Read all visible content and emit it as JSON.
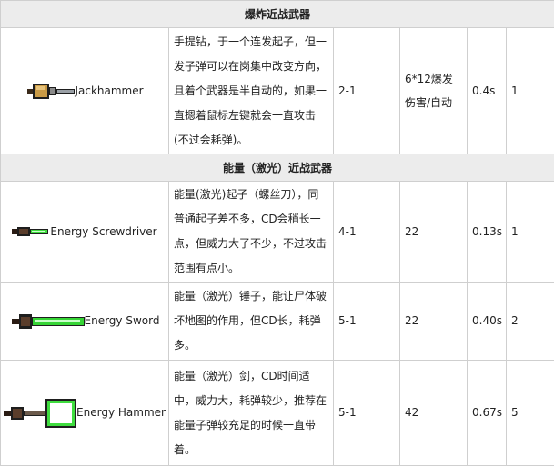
{
  "sections": [
    {
      "title": "爆炸近战武器",
      "rows": [
        {
          "name": "Jackhammer",
          "icon": "jackhammer-icon",
          "description": "手提钻，于一个连发起子，但一发子弹可以在岗集中改变方向，且着个武器是半自动的，如果一直摁着鼠标左键就会一直攻击(不过会耗弹)。",
          "tier": "2-1",
          "damage": "6*12爆发伤害/自动",
          "cd": "0.4s",
          "cost": "1"
        }
      ]
    },
    {
      "title": "能量（激光）近战武器",
      "rows": [
        {
          "name": "Energy Screwdriver",
          "icon": "energy-screwdriver-icon",
          "description": "能量(激光)起子（螺丝刀），同普通起子差不多，CD会稍长一点，但威力大了不少，不过攻击范围有点小。",
          "tier": "4-1",
          "damage": "22",
          "cd": "0.13s",
          "cost": "1"
        },
        {
          "name": "Energy Sword",
          "icon": "energy-sword-icon",
          "description": "能量（激光）锤子，能让尸体破坏地图的作用，但CD长，耗弹多。",
          "tier": "5-1",
          "damage": "22",
          "cd": "0.40s",
          "cost": "2"
        },
        {
          "name": "Energy Hammer",
          "icon": "energy-hammer-icon",
          "description": "能量（激光）剑，CD时间适中，威力大，耗弹较少，推荐在能量子弹较充足的时候一直带着。",
          "tier": "5-1",
          "damage": "42",
          "cd": "0.67s",
          "cost": "5"
        }
      ]
    }
  ]
}
